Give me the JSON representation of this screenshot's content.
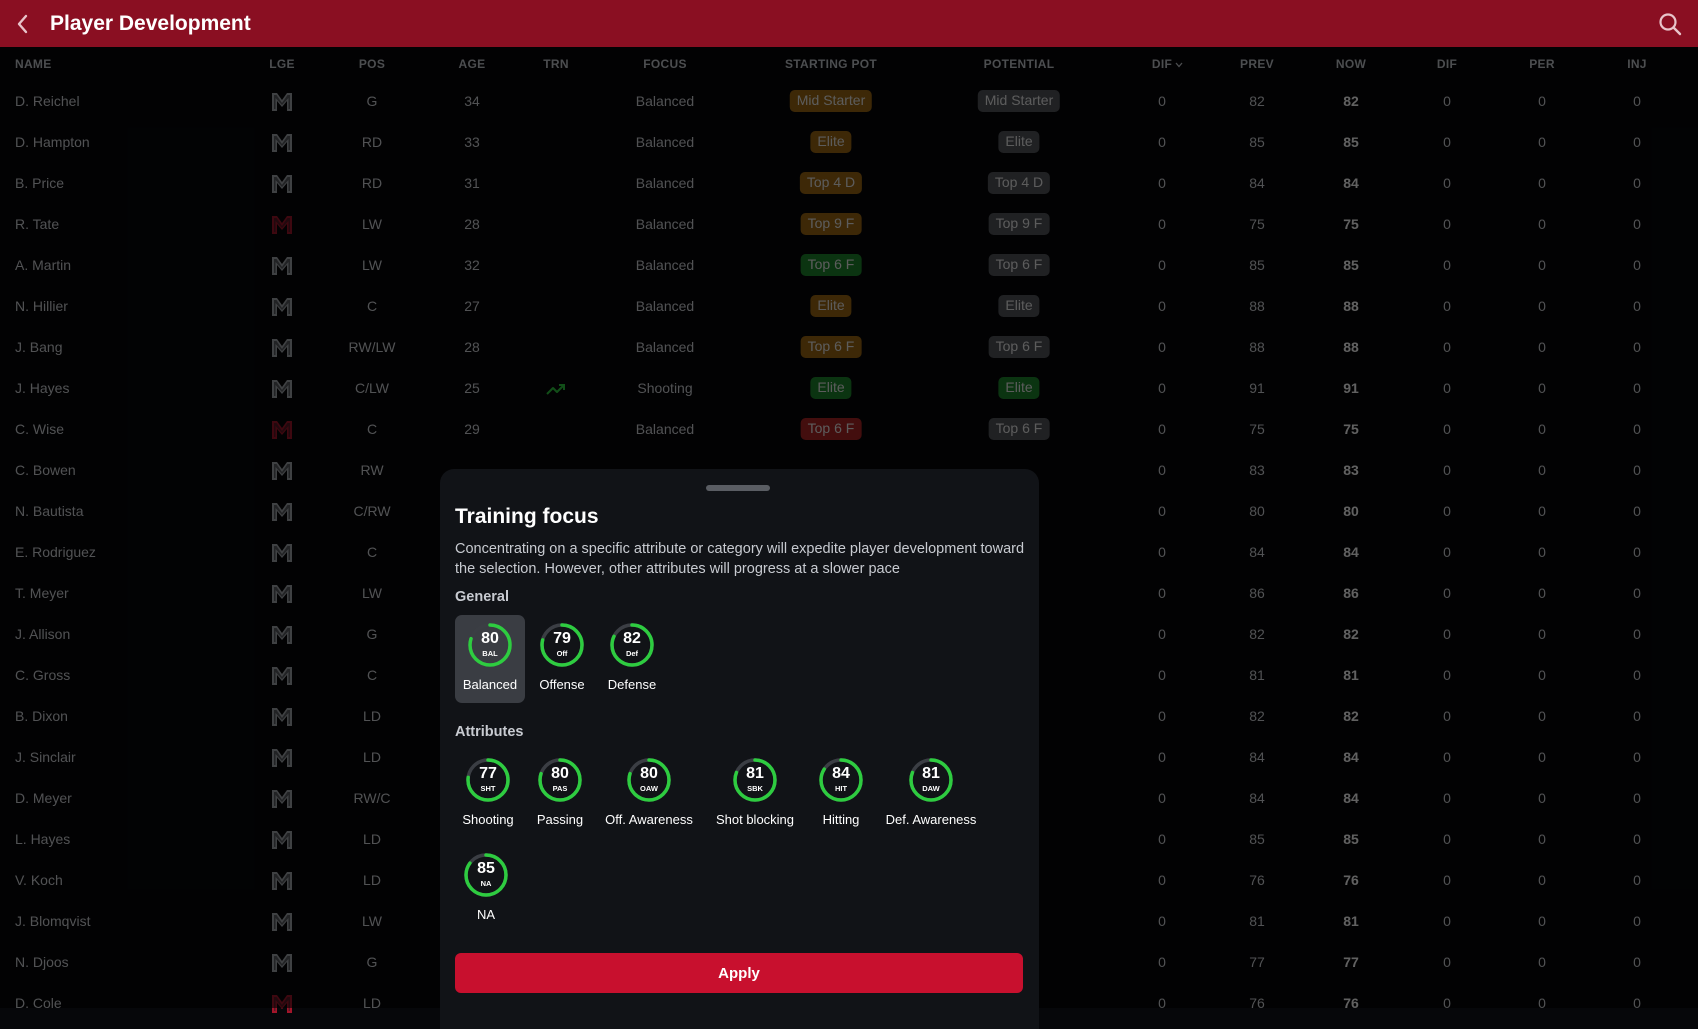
{
  "header": {
    "title": "Player Development",
    "back_icon": "chevron-left-icon",
    "search_icon": "search-icon"
  },
  "columns": [
    "NAME",
    "LGE",
    "POS",
    "AGE",
    "TRN",
    "FOCUS",
    "STARTING POT",
    "POTENTIAL",
    "DIF",
    "PREV",
    "NOW",
    "DIF",
    "PER",
    "INJ"
  ],
  "colors": {
    "header_bg": "#8a0f22",
    "accent": "#c8102e",
    "ring": "#2ecc40",
    "trend": "#2ecc40"
  },
  "players": [
    {
      "name": "D. Reichel",
      "lge": "white",
      "pos": "G",
      "age": "34",
      "trn": "",
      "focus": "Balanced",
      "spot": "Mid Starter",
      "spot_c": "#a06b14",
      "pot": "Mid Starter",
      "pot_c": "#55585e",
      "dif": "0",
      "prev": "82",
      "now": "82",
      "dif2": "0",
      "per": "0",
      "inj": "0"
    },
    {
      "name": "D. Hampton",
      "lge": "white",
      "pos": "RD",
      "age": "33",
      "trn": "",
      "focus": "Balanced",
      "spot": "Elite",
      "spot_c": "#a06b14",
      "pot": "Elite",
      "pot_c": "#55585e",
      "dif": "0",
      "prev": "85",
      "now": "85",
      "dif2": "0",
      "per": "0",
      "inj": "0"
    },
    {
      "name": "B. Price",
      "lge": "white",
      "pos": "RD",
      "age": "31",
      "trn": "",
      "focus": "Balanced",
      "spot": "Top 4 D",
      "spot_c": "#a06b14",
      "pot": "Top 4 D",
      "pot_c": "#55585e",
      "dif": "0",
      "prev": "84",
      "now": "84",
      "dif2": "0",
      "per": "0",
      "inj": "0"
    },
    {
      "name": "R. Tate",
      "lge": "red",
      "pos": "LW",
      "age": "28",
      "trn": "",
      "focus": "Balanced",
      "spot": "Top 9 F",
      "spot_c": "#a06b14",
      "pot": "Top 9 F",
      "pot_c": "#55585e",
      "dif": "0",
      "prev": "75",
      "now": "75",
      "dif2": "0",
      "per": "0",
      "inj": "0"
    },
    {
      "name": "A. Martin",
      "lge": "white",
      "pos": "LW",
      "age": "32",
      "trn": "",
      "focus": "Balanced",
      "spot": "Top 6 F",
      "spot_c": "#1f8a2e",
      "pot": "Top 6 F",
      "pot_c": "#55585e",
      "dif": "0",
      "prev": "85",
      "now": "85",
      "dif2": "0",
      "per": "0",
      "inj": "0"
    },
    {
      "name": "N. Hillier",
      "lge": "white",
      "pos": "C",
      "age": "27",
      "trn": "",
      "focus": "Balanced",
      "spot": "Elite",
      "spot_c": "#a06b14",
      "pot": "Elite",
      "pot_c": "#55585e",
      "dif": "0",
      "prev": "88",
      "now": "88",
      "dif2": "0",
      "per": "0",
      "inj": "0"
    },
    {
      "name": "J. Bang",
      "lge": "white",
      "pos": "RW/LW",
      "age": "28",
      "trn": "",
      "focus": "Balanced",
      "spot": "Top 6 F",
      "spot_c": "#a06b14",
      "pot": "Top 6 F",
      "pot_c": "#55585e",
      "dif": "0",
      "prev": "88",
      "now": "88",
      "dif2": "0",
      "per": "0",
      "inj": "0"
    },
    {
      "name": "J. Hayes",
      "lge": "white",
      "pos": "C/LW",
      "age": "25",
      "trn": "up",
      "focus": "Shooting",
      "spot": "Elite",
      "spot_c": "#1f8a2e",
      "pot": "Elite",
      "pot_c": "#1f8a2e",
      "dif": "0",
      "prev": "91",
      "now": "91",
      "dif2": "0",
      "per": "0",
      "inj": "0"
    },
    {
      "name": "C. Wise",
      "lge": "red",
      "pos": "C",
      "age": "29",
      "trn": "",
      "focus": "Balanced",
      "spot": "Top 6 F",
      "spot_c": "#b02525",
      "pot": "Top 6 F",
      "pot_c": "#55585e",
      "dif": "0",
      "prev": "75",
      "now": "75",
      "dif2": "0",
      "per": "0",
      "inj": "0"
    },
    {
      "name": "C. Bowen",
      "lge": "white",
      "pos": "RW",
      "age": "",
      "trn": "",
      "focus": "",
      "spot": "",
      "spot_c": "#1f8a2e",
      "pot": "",
      "pot_c": "#55585e",
      "dif": "0",
      "prev": "83",
      "now": "83",
      "dif2": "0",
      "per": "0",
      "inj": "0"
    },
    {
      "name": "N. Bautista",
      "lge": "white",
      "pos": "C/RW",
      "age": "",
      "trn": "",
      "focus": "",
      "spot": "",
      "spot_c": "",
      "pot": "",
      "pot_c": "",
      "dif": "0",
      "prev": "80",
      "now": "80",
      "dif2": "0",
      "per": "0",
      "inj": "0"
    },
    {
      "name": "E. Rodriguez",
      "lge": "white",
      "pos": "C",
      "age": "",
      "trn": "",
      "focus": "",
      "spot": "",
      "spot_c": "",
      "pot": "",
      "pot_c": "",
      "dif": "0",
      "prev": "84",
      "now": "84",
      "dif2": "0",
      "per": "0",
      "inj": "0"
    },
    {
      "name": "T. Meyer",
      "lge": "white",
      "pos": "LW",
      "age": "",
      "trn": "",
      "focus": "",
      "spot": "",
      "spot_c": "",
      "pot": "",
      "pot_c": "",
      "dif": "0",
      "prev": "86",
      "now": "86",
      "dif2": "0",
      "per": "0",
      "inj": "0"
    },
    {
      "name": "J. Allison",
      "lge": "white",
      "pos": "G",
      "age": "",
      "trn": "",
      "focus": "",
      "spot": "",
      "spot_c": "",
      "pot": "",
      "pot_c": "",
      "dif": "0",
      "prev": "82",
      "now": "82",
      "dif2": "0",
      "per": "0",
      "inj": "0"
    },
    {
      "name": "C. Gross",
      "lge": "white",
      "pos": "C",
      "age": "",
      "trn": "",
      "focus": "",
      "spot": "",
      "spot_c": "",
      "pot": "",
      "pot_c": "",
      "dif": "0",
      "prev": "81",
      "now": "81",
      "dif2": "0",
      "per": "0",
      "inj": "0"
    },
    {
      "name": "B. Dixon",
      "lge": "white",
      "pos": "LD",
      "age": "",
      "trn": "",
      "focus": "",
      "spot": "",
      "spot_c": "",
      "pot": "",
      "pot_c": "",
      "dif": "0",
      "prev": "82",
      "now": "82",
      "dif2": "0",
      "per": "0",
      "inj": "0"
    },
    {
      "name": "J. Sinclair",
      "lge": "white",
      "pos": "LD",
      "age": "",
      "trn": "",
      "focus": "",
      "spot": "",
      "spot_c": "",
      "pot": "",
      "pot_c": "",
      "dif": "0",
      "prev": "84",
      "now": "84",
      "dif2": "0",
      "per": "0",
      "inj": "0"
    },
    {
      "name": "D. Meyer",
      "lge": "white",
      "pos": "RW/C",
      "age": "",
      "trn": "",
      "focus": "",
      "spot": "",
      "spot_c": "",
      "pot": "",
      "pot_c": "",
      "dif": "0",
      "prev": "84",
      "now": "84",
      "dif2": "0",
      "per": "0",
      "inj": "0"
    },
    {
      "name": "L. Hayes",
      "lge": "white",
      "pos": "LD",
      "age": "",
      "trn": "",
      "focus": "",
      "spot": "",
      "spot_c": "",
      "pot": "",
      "pot_c": "",
      "dif": "0",
      "prev": "85",
      "now": "85",
      "dif2": "0",
      "per": "0",
      "inj": "0"
    },
    {
      "name": "V. Koch",
      "lge": "white",
      "pos": "LD",
      "age": "",
      "trn": "",
      "focus": "",
      "spot": "",
      "spot_c": "",
      "pot": "",
      "pot_c": "",
      "dif": "0",
      "prev": "76",
      "now": "76",
      "dif2": "0",
      "per": "0",
      "inj": "0"
    },
    {
      "name": "J. Blomqvist",
      "lge": "white",
      "pos": "LW",
      "age": "",
      "trn": "",
      "focus": "",
      "spot": "",
      "spot_c": "",
      "pot": "",
      "pot_c": "",
      "dif": "0",
      "prev": "81",
      "now": "81",
      "dif2": "0",
      "per": "0",
      "inj": "0"
    },
    {
      "name": "N. Djoos",
      "lge": "white",
      "pos": "G",
      "age": "",
      "trn": "",
      "focus": "",
      "spot": "",
      "spot_c": "",
      "pot": "",
      "pot_c": "",
      "dif": "0",
      "prev": "77",
      "now": "77",
      "dif2": "0",
      "per": "0",
      "inj": "0"
    },
    {
      "name": "D. Cole",
      "lge": "red",
      "pos": "LD",
      "age": "",
      "trn": "",
      "focus": "",
      "spot": "",
      "spot_c": "",
      "pot": "",
      "pot_c": "",
      "dif": "0",
      "prev": "76",
      "now": "76",
      "dif2": "0",
      "per": "0",
      "inj": "0"
    }
  ],
  "modal": {
    "title": "Training focus",
    "description": "Concentrating on a specific attribute or category will expedite player development toward the selection. However, other attributes will progress at a slower pace",
    "general_label": "General",
    "attributes_label": "Attributes",
    "general": [
      {
        "value": "80",
        "abbr": "BAL",
        "label": "Balanced",
        "selected": true
      },
      {
        "value": "79",
        "abbr": "Off",
        "label": "Offense",
        "selected": false
      },
      {
        "value": "82",
        "abbr": "Def",
        "label": "Defense",
        "selected": false
      }
    ],
    "attributes": [
      {
        "value": "77",
        "abbr": "SHT",
        "label": "Shooting"
      },
      {
        "value": "80",
        "abbr": "PAS",
        "label": "Passing"
      },
      {
        "value": "80",
        "abbr": "OAW",
        "label": "Off. Awareness"
      },
      {
        "value": "81",
        "abbr": "SBK",
        "label": "Shot blocking"
      },
      {
        "value": "84",
        "abbr": "HIT",
        "label": "Hitting"
      },
      {
        "value": "81",
        "abbr": "DAW",
        "label": "Def. Awareness"
      },
      {
        "value": "85",
        "abbr": "NA",
        "label": "NA"
      }
    ],
    "apply_label": "Apply"
  }
}
